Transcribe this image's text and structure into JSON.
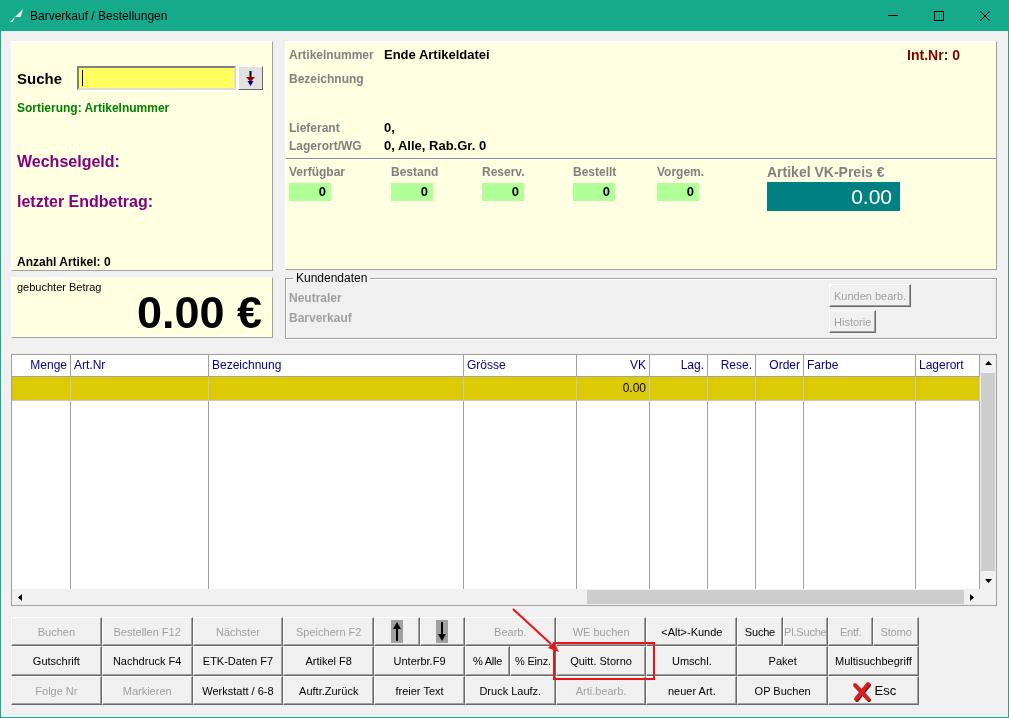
{
  "window": {
    "title": "Barverkauf / Bestellungen"
  },
  "search_panel": {
    "search": {
      "label": "Suche",
      "focused": true
    },
    "sort_info": "Sortierung: Artikelnummer",
    "change_label": "Wechselgeld:",
    "last_total_label": "letzter Endbetrag:",
    "item_count": "Anzahl Artikel: 0"
  },
  "booked_amount": {
    "label": "gebuchter Betrag",
    "amount": "0.00 €"
  },
  "article": {
    "fields": [
      {
        "label": "Artikelnummer",
        "value": "Ende Artikeldatei"
      },
      {
        "label": "Bezeichnung"
      },
      {
        "label": "Lieferant",
        "value": "0,"
      },
      {
        "label": "Lagerort/WG",
        "value": "0, Alle, Rab.Gr. 0"
      }
    ],
    "int_nr": "Int.Nr: 0",
    "stock": [
      {
        "label": "Verfügbar",
        "value": "0"
      },
      {
        "label": "Bestand",
        "value": "0"
      },
      {
        "label": "Reserv.",
        "value": "0"
      },
      {
        "label": "Bestellt",
        "value": "0"
      },
      {
        "label": "Vorgem.",
        "value": "0"
      }
    ],
    "price": {
      "label": "Artikel VK-Preis €",
      "value": "0.00"
    }
  },
  "customer": {
    "title": "Kundendaten",
    "lines": [
      "Neutraler",
      "Barverkauf"
    ],
    "buttons": [
      {
        "label": "Kunden bearb.",
        "disabled": true
      },
      {
        "label": "Historie",
        "disabled": true
      }
    ]
  },
  "table": {
    "columns": [
      "Menge",
      "Art.Nr",
      "Bezeichnung",
      "Grösse",
      "VK",
      "Lag.",
      "Rese.",
      "Order",
      "Farbe",
      "Lagerort"
    ],
    "rows": [
      {
        "selected": true,
        "vk": "0.00"
      }
    ]
  },
  "button_rows": [
    [
      {
        "kind": "text",
        "label": "Buchen",
        "disabled": true,
        "highlighted": false
      },
      {
        "kind": "text",
        "label": "Bestellen F12",
        "disabled": true,
        "highlighted": false
      },
      {
        "kind": "text",
        "label": "Nächster",
        "disabled": true,
        "highlighted": false
      },
      {
        "kind": "text",
        "label": "Speichern F2",
        "disabled": true,
        "highlighted": false
      },
      {
        "kind": "up-arrow",
        "disabled": false,
        "highlighted": false
      },
      {
        "kind": "down-arrow",
        "disabled": false,
        "highlighted": false
      },
      {
        "kind": "text",
        "label": "Bearb.",
        "disabled": true,
        "highlighted": false
      },
      {
        "kind": "text",
        "label": "WE buchen",
        "disabled": true,
        "highlighted": false
      },
      {
        "kind": "text",
        "label": "<Alt>-Kunde",
        "disabled": false,
        "highlighted": false
      },
      {
        "kind": "text",
        "label": "Suche",
        "disabled": false,
        "highlighted": false
      },
      {
        "kind": "text",
        "label": "Pl.Suche",
        "disabled": true,
        "highlighted": false
      },
      {
        "kind": "text",
        "label": "Entf.",
        "disabled": true,
        "highlighted": false
      },
      {
        "kind": "text",
        "label": "Storno",
        "disabled": true,
        "highlighted": false
      }
    ],
    [
      {
        "kind": "text",
        "label": "Gutschrift",
        "disabled": false,
        "highlighted": false
      },
      {
        "kind": "text",
        "label": "Nachdruck F4",
        "disabled": false,
        "highlighted": false
      },
      {
        "kind": "text",
        "label": "ETK-Daten F7",
        "disabled": false,
        "highlighted": false
      },
      {
        "kind": "text",
        "label": "Artikel F8",
        "disabled": false,
        "highlighted": false
      },
      {
        "kind": "text",
        "label": "Unterbr.F9",
        "disabled": false,
        "highlighted": false
      },
      {
        "kind": "text",
        "label": "% Alle",
        "disabled": false,
        "highlighted": false
      },
      {
        "kind": "text",
        "label": "% Einz.",
        "disabled": false,
        "highlighted": false
      },
      {
        "kind": "text",
        "label": "Quitt. Storno",
        "disabled": false,
        "highlighted": true
      },
      {
        "kind": "text",
        "label": "Umschl.",
        "disabled": false,
        "highlighted": false
      },
      {
        "kind": "text",
        "label": "Paket",
        "disabled": false,
        "highlighted": false
      },
      {
        "kind": "text",
        "label": "Multisuchbegriff",
        "disabled": false,
        "highlighted": false
      }
    ],
    [
      {
        "kind": "text",
        "label": "Folge Nr",
        "disabled": true,
        "highlighted": false
      },
      {
        "kind": "text",
        "label": "Markieren",
        "disabled": true,
        "highlighted": false
      },
      {
        "kind": "text",
        "label": "Werkstatt / 6-8",
        "disabled": false,
        "highlighted": false
      },
      {
        "kind": "text",
        "label": "Auftr.Zurück",
        "disabled": false,
        "highlighted": false
      },
      {
        "kind": "text",
        "label": "freier Text",
        "disabled": false,
        "highlighted": false
      },
      {
        "kind": "text",
        "label": "Druck Laufz.",
        "disabled": false,
        "highlighted": false
      },
      {
        "kind": "text",
        "label": "Arti.bearb.",
        "disabled": true,
        "highlighted": false
      },
      {
        "kind": "text",
        "label": "neuer Art.",
        "disabled": false,
        "highlighted": false
      },
      {
        "kind": "text",
        "label": "OP Buchen",
        "disabled": false,
        "highlighted": false
      },
      {
        "kind": "esc",
        "label": "Esc",
        "disabled": false,
        "highlighted": false
      }
    ]
  ]
}
